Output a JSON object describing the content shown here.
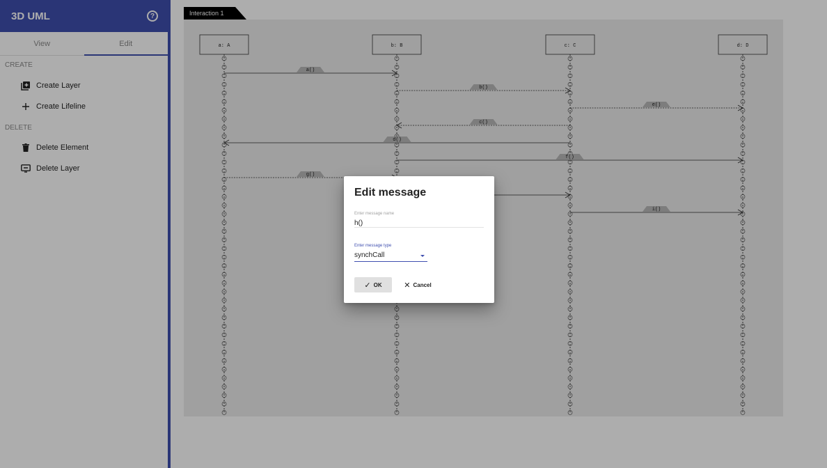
{
  "app": {
    "title": "3D UML",
    "help_icon": "help-circle-icon"
  },
  "colors": {
    "accent": "#3f4faf",
    "frame": "#ececec",
    "overlay": "rgba(0,0,0,0.32)"
  },
  "tabs": [
    {
      "label": "View",
      "active": false
    },
    {
      "label": "Edit",
      "active": true
    }
  ],
  "create_section": {
    "header": "CREATE",
    "items": [
      {
        "label": "Create Layer",
        "icon": "add-layer-icon"
      },
      {
        "label": "Create Lifeline",
        "icon": "plus-icon"
      }
    ]
  },
  "delete_section": {
    "header": "DELETE",
    "items": [
      {
        "label": "Delete Element",
        "icon": "trash-icon"
      },
      {
        "label": "Delete Layer",
        "icon": "remove-layer-icon"
      }
    ]
  },
  "interaction": {
    "tab_label": "Interaction 1"
  },
  "lifelines": [
    "a: A",
    "b: B",
    "c: C",
    "d: D"
  ],
  "messages": [
    {
      "label": "a()",
      "from": 0,
      "to": 1,
      "style": "solid"
    },
    {
      "label": "b()",
      "from": 1,
      "to": 2,
      "style": "dashed"
    },
    {
      "label": "e()",
      "from": 2,
      "to": 3,
      "style": "dashed"
    },
    {
      "label": "c()",
      "from": 2,
      "to": 1,
      "style": "dashed"
    },
    {
      "label": "d()",
      "from": 2,
      "to": 0,
      "style": "solid"
    },
    {
      "label": "f()",
      "from": 1,
      "to": 3,
      "style": "solid"
    },
    {
      "label": "g()",
      "from": 0,
      "to": 1,
      "style": "dashed"
    },
    {
      "label": "",
      "from": 1,
      "to": 2,
      "style": "solid"
    },
    {
      "label": "i()",
      "from": 2,
      "to": 3,
      "style": "solid"
    }
  ],
  "dialog": {
    "title": "Edit message",
    "name_label": "Enter message name",
    "name_value": "h()",
    "type_label": "Enter message type",
    "type_value": "synchCall",
    "ok_label": "OK",
    "cancel_label": "Cancel"
  }
}
